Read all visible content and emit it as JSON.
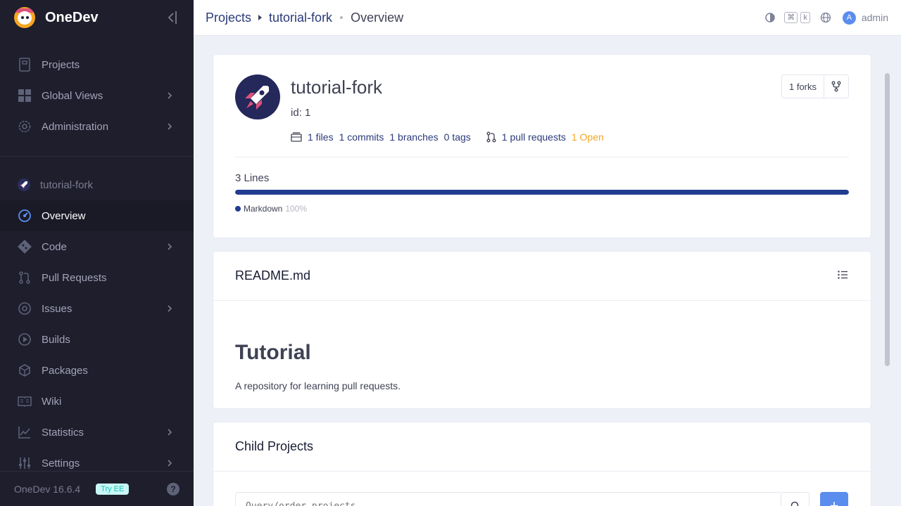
{
  "app": {
    "name": "OneDev",
    "version": "OneDev 16.6.4",
    "try_ee": "Try EE",
    "help": "?"
  },
  "sidebar": {
    "global_items": [
      {
        "label": "Projects",
        "icon": "projects-icon",
        "has_children": false
      },
      {
        "label": "Global Views",
        "icon": "grid-icon",
        "has_children": true
      },
      {
        "label": "Administration",
        "icon": "gear-icon",
        "has_children": true
      }
    ],
    "project_name": "tutorial-fork",
    "project_items": [
      {
        "label": "Overview",
        "icon": "gauge-icon",
        "has_children": false,
        "active": true
      },
      {
        "label": "Code",
        "icon": "git-icon",
        "has_children": true
      },
      {
        "label": "Pull Requests",
        "icon": "pull-request-icon",
        "has_children": false
      },
      {
        "label": "Issues",
        "icon": "issue-icon",
        "has_children": true
      },
      {
        "label": "Builds",
        "icon": "play-icon",
        "has_children": false
      },
      {
        "label": "Packages",
        "icon": "box-icon",
        "has_children": false
      },
      {
        "label": "Wiki",
        "icon": "book-icon",
        "has_children": false
      },
      {
        "label": "Statistics",
        "icon": "chart-icon",
        "has_children": true
      },
      {
        "label": "Settings",
        "icon": "sliders-icon",
        "has_children": true
      }
    ]
  },
  "topbar": {
    "breadcrumb": [
      "Projects",
      "tutorial-fork",
      "Overview"
    ],
    "kbd_cmd": "⌘",
    "kbd_k": "k",
    "user_initial": "A",
    "user_name": "admin"
  },
  "project": {
    "title": "tutorial-fork",
    "id": "id: 1",
    "stats": {
      "files": "1 files",
      "commits": "1 commits",
      "branches": "1 branches",
      "tags": "0 tags",
      "pull_requests": "1 pull requests",
      "open": "1 Open"
    },
    "forks": "1 forks",
    "lines": "3 Lines",
    "language": {
      "name": "Markdown",
      "percent_label": "100%",
      "fraction": 1.0,
      "color": "#223c8f"
    }
  },
  "readme": {
    "filename": "README.md",
    "heading": "Tutorial",
    "paragraph": "A repository for learning pull requests."
  },
  "child_projects": {
    "title": "Child Projects",
    "search_placeholder": "Query/order projects",
    "add_label": "+"
  }
}
